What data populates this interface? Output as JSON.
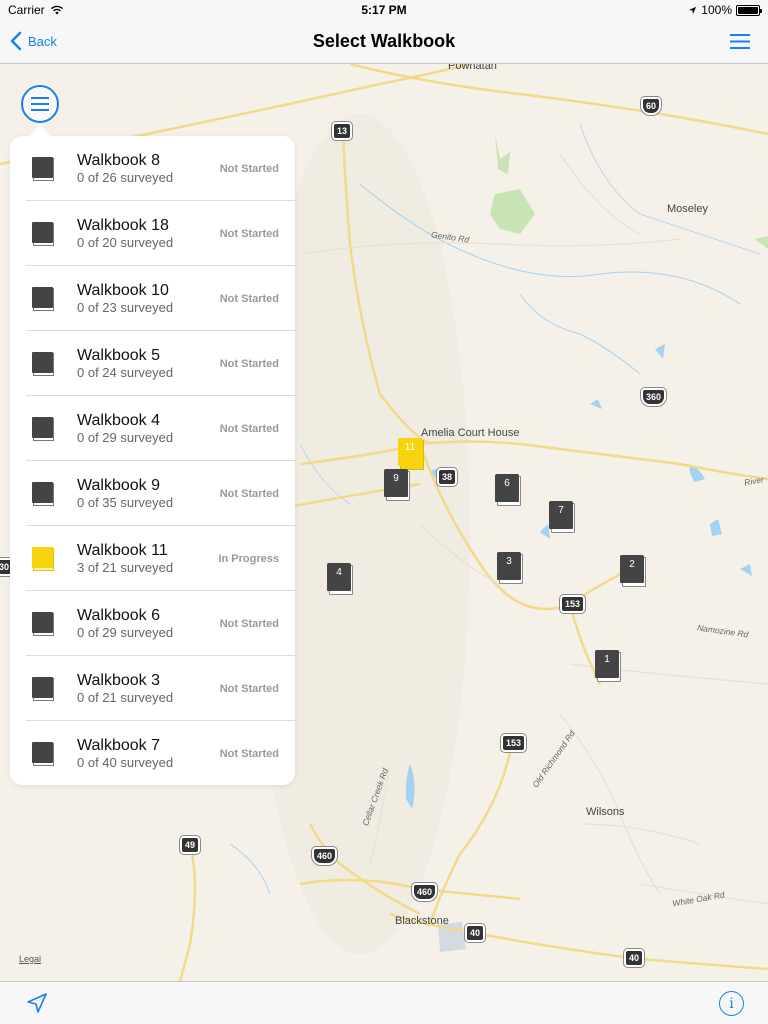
{
  "status_bar": {
    "carrier": "Carrier",
    "time": "5:17 PM",
    "battery": "100%"
  },
  "nav": {
    "back_label": "Back",
    "title": "Select Walkbook",
    "menu_icon": "hamburger-icon"
  },
  "map": {
    "places": {
      "powhatan": "Powhatan",
      "moseley": "Moseley",
      "amelia": "Amelia Court House",
      "wilsons": "Wilsons",
      "blackstone": "Blackstone"
    },
    "roads": {
      "genito": "Genito Rd",
      "namozine": "Namozine Rd",
      "river": "River",
      "cellar_creek": "Cellar Creek Rd",
      "old_richmond": "Old Richmond Rd",
      "white_oak": "White Oak Rd"
    },
    "shields": {
      "s13": "13",
      "s60": "60",
      "s360": "360",
      "s38": "38",
      "s153a": "153",
      "s153b": "153",
      "s49": "49",
      "s460a": "460",
      "s460b": "460",
      "s40a": "40",
      "s40b": "40",
      "s30": "30"
    },
    "markers": {
      "m11": "11",
      "m9": "9",
      "m6": "6",
      "m7": "7",
      "m3": "3",
      "m2": "2",
      "m4": "4",
      "m1": "1"
    },
    "legal": "Legal"
  },
  "walkbooks": [
    {
      "name": "Walkbook 8",
      "progress": "0 of 26 surveyed",
      "status": "Not Started",
      "active": false
    },
    {
      "name": "Walkbook 18",
      "progress": "0 of 20 surveyed",
      "status": "Not Started",
      "active": false
    },
    {
      "name": "Walkbook 10",
      "progress": "0 of 23 surveyed",
      "status": "Not Started",
      "active": false
    },
    {
      "name": "Walkbook 5",
      "progress": "0 of 24 surveyed",
      "status": "Not Started",
      "active": false
    },
    {
      "name": "Walkbook 4",
      "progress": "0 of 29 surveyed",
      "status": "Not Started",
      "active": false
    },
    {
      "name": "Walkbook 9",
      "progress": "0 of 35 surveyed",
      "status": "Not Started",
      "active": false
    },
    {
      "name": "Walkbook 11",
      "progress": "3 of 21 surveyed",
      "status": "In Progress",
      "active": true
    },
    {
      "name": "Walkbook 6",
      "progress": "0 of 29 surveyed",
      "status": "Not Started",
      "active": false
    },
    {
      "name": "Walkbook 3",
      "progress": "0 of 21 surveyed",
      "status": "Not Started",
      "active": false
    },
    {
      "name": "Walkbook 7",
      "progress": "0 of 40 surveyed",
      "status": "Not Started",
      "active": false
    }
  ],
  "toolbar": {
    "info_label": "i"
  },
  "colors": {
    "accent": "#1a7ff5",
    "active_walkbook": "#f7d40d",
    "map_bg": "#f5f1e8"
  }
}
